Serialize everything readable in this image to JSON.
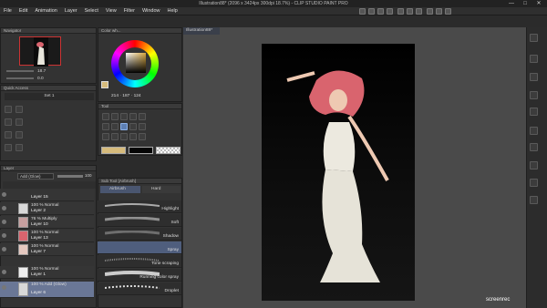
{
  "window": {
    "title": "Illustration88* (2096 x 3424px 300dpi 18.7%)  - CLIP STUDIO PAINT PRO",
    "minimize": "—",
    "maximize": "□",
    "close": "✕"
  },
  "menu": [
    "File",
    "Edit",
    "Animation",
    "Layer",
    "Select",
    "View",
    "Filter",
    "Window",
    "Help"
  ],
  "navigator": {
    "header": "Navigator",
    "zoom": "18.7",
    "angle": "0.0"
  },
  "color": {
    "header": "Color wh...",
    "values": [
      "214",
      "187",
      "124"
    ]
  },
  "quick_access": {
    "header": "Quick Access",
    "set_label": "Set 1"
  },
  "tool": {
    "header": "Tool"
  },
  "sub_tool": {
    "header": "Sub Tool [Airbrush]",
    "tabs": [
      "Airbrush",
      "Hard"
    ],
    "items": [
      "Highlight",
      "Soft",
      "Shadow",
      "Spray",
      "Tone scraping",
      "Running color spray",
      "Droplet"
    ]
  },
  "layer": {
    "header": "Layer",
    "blend_mode": "Add (Glow)",
    "opacity": "100",
    "rows": [
      {
        "mode": "",
        "name": "Layer 15"
      },
      {
        "mode": "100 % Normal",
        "name": "Layer 2"
      },
      {
        "mode": "76 % Multiply",
        "name": "Layer 10"
      },
      {
        "mode": "100 % Normal",
        "name": "Layer 13"
      },
      {
        "mode": "100 % Normal",
        "name": "Layer 7"
      },
      {
        "mode": "100 % Normal",
        "name": "Layer 1"
      },
      {
        "mode": "100 % Add (Glow)",
        "name": "Layer 6"
      }
    ]
  },
  "canvas": {
    "tab": "Illustration88*"
  },
  "watermark": {
    "brand": "screenrec"
  },
  "colors": {
    "accent": "#5d7fb3",
    "selection": "#6a7796",
    "dress": "#e8e6dc",
    "hair": "#d9646e"
  }
}
